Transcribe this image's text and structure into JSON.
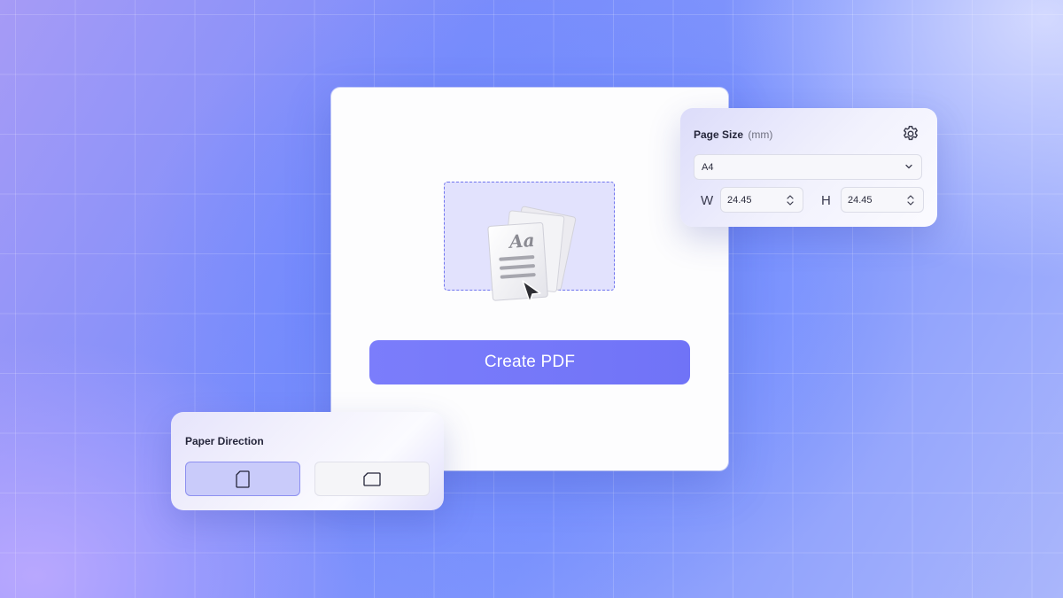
{
  "main_card": {
    "create_button_label": "Create PDF",
    "illustration_text": "Aa"
  },
  "page_size_panel": {
    "title": "Page Size",
    "unit": "(mm)",
    "size_select": {
      "selected": "A4"
    },
    "width": {
      "label": "W",
      "value": "24.45"
    },
    "height": {
      "label": "H",
      "value": "24.45"
    }
  },
  "paper_direction_panel": {
    "title": "Paper Direction",
    "options": [
      {
        "id": "portrait",
        "icon": "portrait-page-icon",
        "selected": true
      },
      {
        "id": "landscape",
        "icon": "landscape-page-icon",
        "selected": false
      }
    ]
  },
  "colors": {
    "accent": "#7073f7",
    "drop_zone_fill": "#e2e2fd",
    "drop_zone_border": "#6f74ee",
    "selected_option_fill": "#c9cbfa"
  }
}
